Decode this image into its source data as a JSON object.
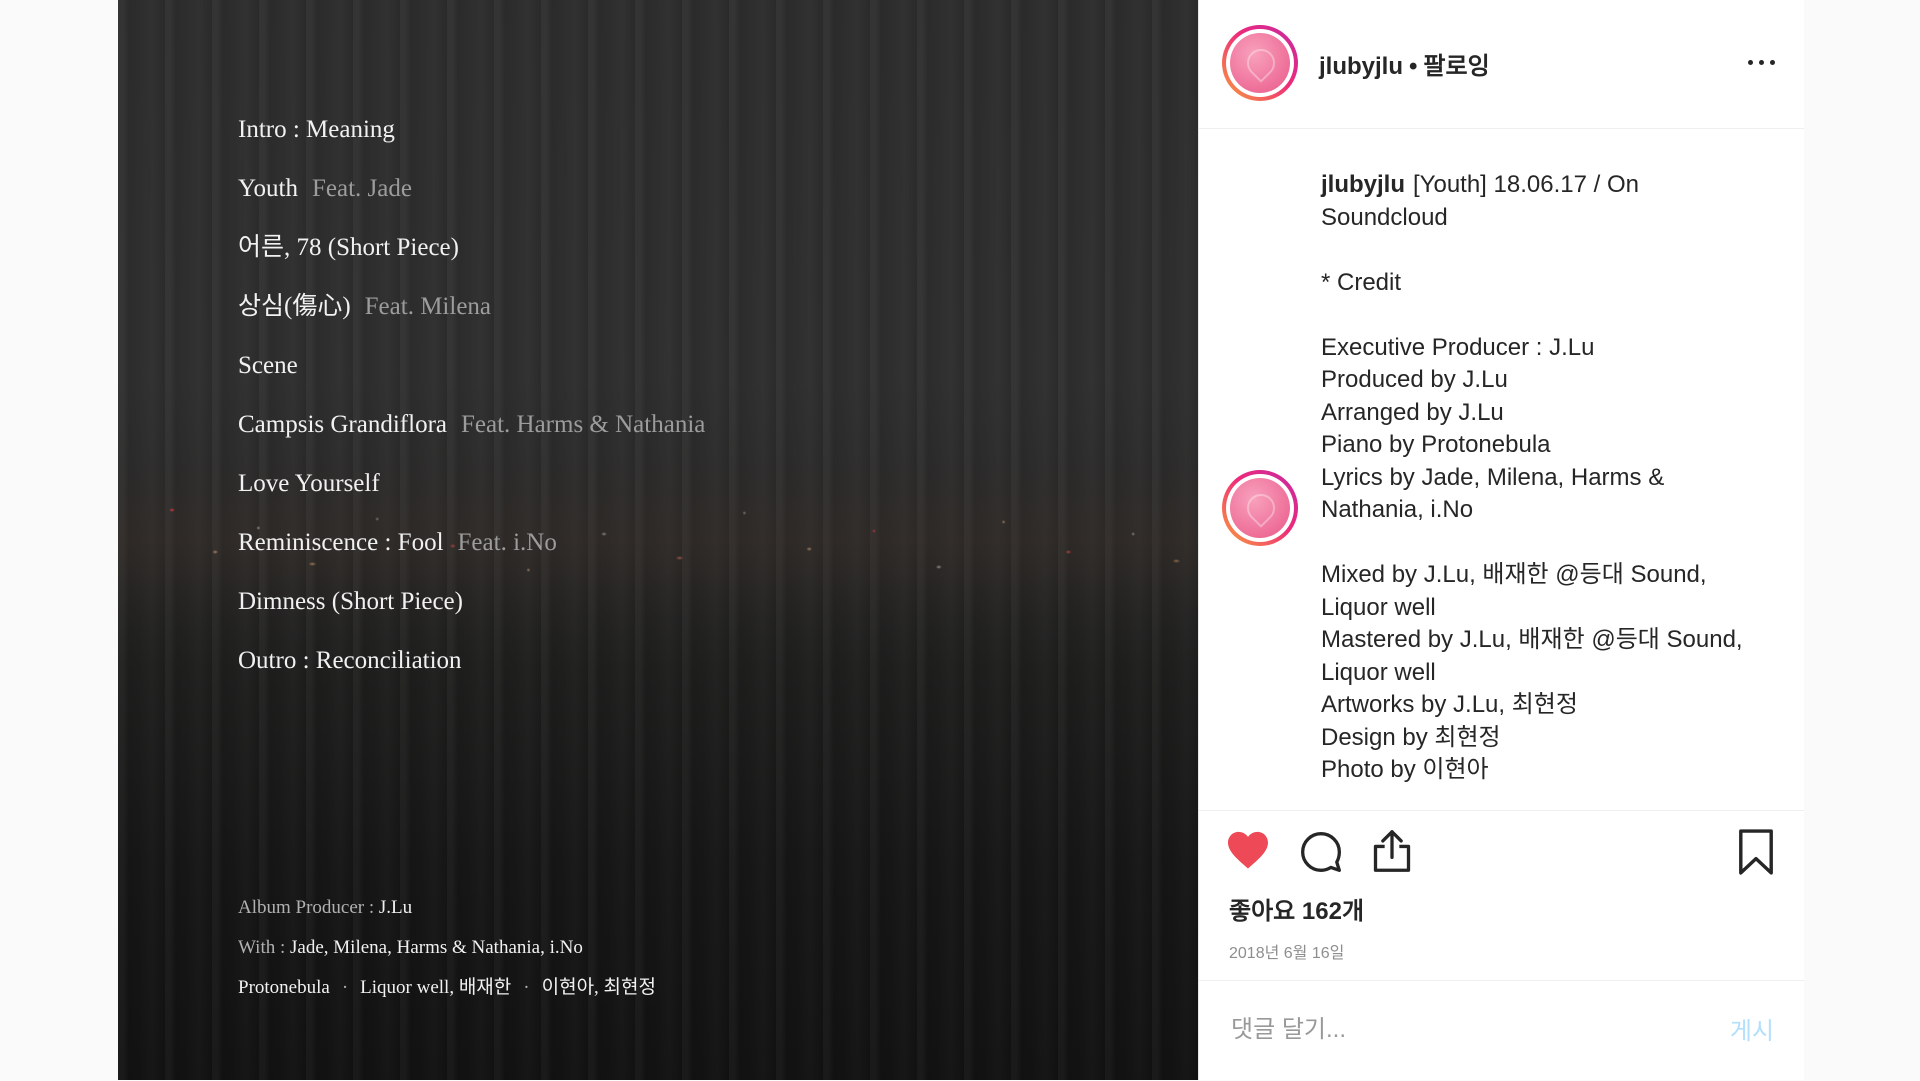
{
  "album_art": {
    "tracks": [
      {
        "title": "Intro : Meaning",
        "feat": ""
      },
      {
        "title": "Youth",
        "feat": "Feat. Jade"
      },
      {
        "title": "어른, 78 (Short Piece)",
        "feat": ""
      },
      {
        "title": "상심(傷心)",
        "feat": "Feat. Milena"
      },
      {
        "title": "Scene",
        "feat": ""
      },
      {
        "title": "Campsis Grandiflora",
        "feat": "Feat. Harms & Nathania"
      },
      {
        "title": "Love Yourself",
        "feat": ""
      },
      {
        "title": "Reminiscence : Fool",
        "feat": "Feat. i.No"
      },
      {
        "title": "Dimness (Short Piece)",
        "feat": ""
      },
      {
        "title": "Outro : Reconciliation",
        "feat": ""
      }
    ],
    "credits": {
      "producer_label": "Album Producer : ",
      "producer": "J.Lu",
      "with_label": "With : ",
      "with": "Jade, Milena, Harms & Nathania, i.No",
      "extra": [
        "Protonebula",
        "Liquor well, 배재한",
        "이현아, 최현정"
      ],
      "separator": "·"
    }
  },
  "header": {
    "username": "jlubyjlu",
    "separator": "•",
    "follow_status": "팔로잉"
  },
  "caption": {
    "username": "jlubyjlu",
    "lines": [
      "[Youth] 18.06.17 / On",
      "Soundcloud",
      "",
      "* Credit",
      "",
      "Executive Producer : J.Lu",
      "Produced by J.Lu",
      "Arranged by J.Lu",
      "Piano by Protonebula",
      "Lyrics by Jade, Milena, Harms &",
      "Nathania, i.No",
      "",
      "Mixed by J.Lu, 배재한 @등대 Sound,",
      "Liquor well",
      "Mastered by J.Lu, 배재한 @등대 Sound,",
      "Liquor well",
      "Artworks by J.Lu, 최현정",
      "Design by 최현정",
      "Photo by 이현아"
    ]
  },
  "actions": {
    "likes_text": "좋아요 162개",
    "date_text": "2018년 6월 16일"
  },
  "comment": {
    "placeholder": "댓글 달기...",
    "post_label": "게시"
  },
  "icons": {
    "like": "heart-filled-icon",
    "comment": "speech-bubble-icon",
    "share": "share-upload-icon",
    "save": "bookmark-icon",
    "more": "more-dots-icon"
  },
  "colors": {
    "like_red": "#ed4956",
    "post_button_disabled": "#b2dffc",
    "avatar_pink": "#ee6e98",
    "text_primary": "#262626",
    "text_secondary": "#8e8e8e"
  }
}
